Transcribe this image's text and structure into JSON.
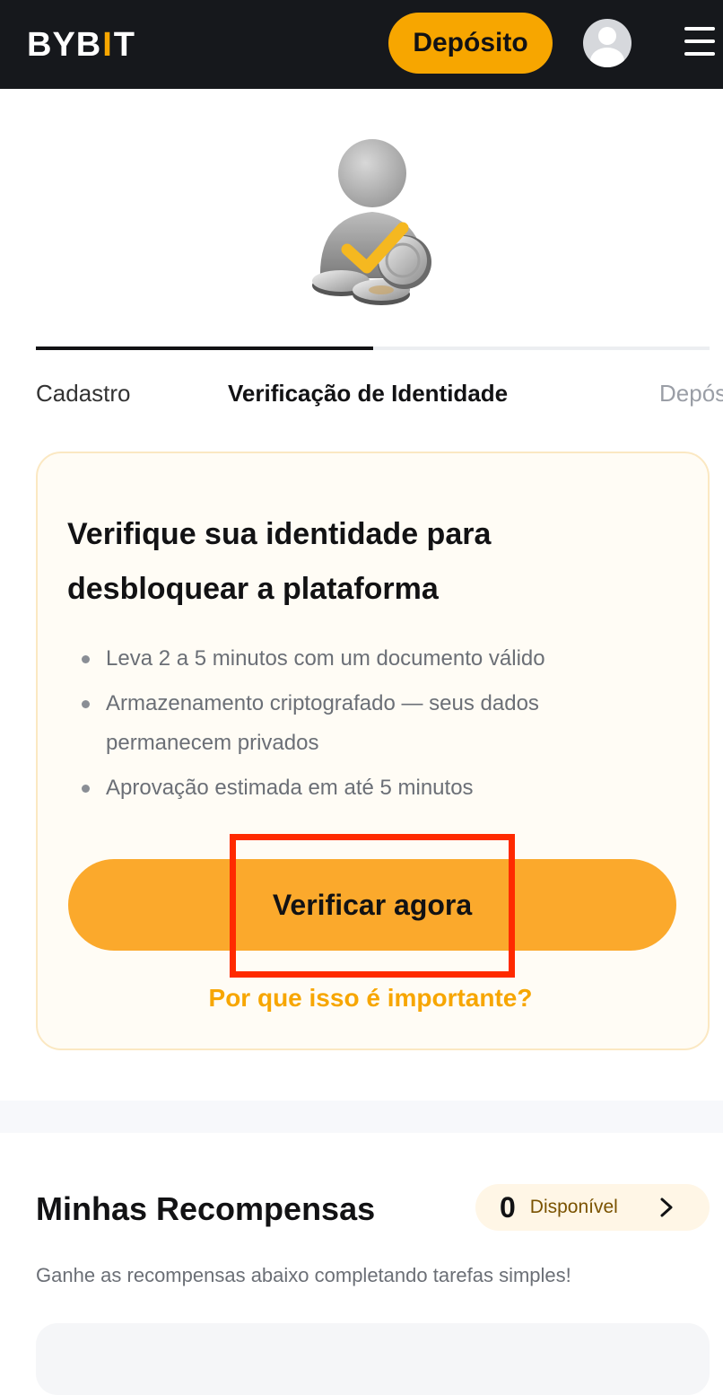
{
  "header": {
    "logo_text": "BYB",
    "logo_mark": "I",
    "logo_tail": "T",
    "deposit_label": "Depósito",
    "icons": [
      "avatar-icon",
      "hamburger-menu-icon"
    ]
  },
  "hero": {
    "icon": "user-verified-coins-icon"
  },
  "stepper": {
    "progress_fraction": 0.5,
    "steps": [
      {
        "label": "Cadastro",
        "state": "done"
      },
      {
        "label": "Verificação de Identidade",
        "state": "active"
      },
      {
        "label": "Depós",
        "state": "upcoming"
      }
    ]
  },
  "verification_card": {
    "title_line1": "Verifique sua identidade para",
    "title_line2": "desbloquear a plataforma",
    "bullets": [
      "Leva 2 a 5 minutos com um documento válido",
      "Armazenamento criptografado — seus dados permanecem privados",
      "Aprovação estimada em até 5 minutos"
    ],
    "button_label": "Verificar agora",
    "link_label": "Por que isso é importante?"
  },
  "rewards": {
    "title": "Minhas Recompensas",
    "available_count": "0",
    "available_label": "Disponível",
    "subtitle": "Ganhe as recompensas abaixo completando tarefas simples!"
  },
  "colors": {
    "header_bg": "#16181c",
    "accent": "#f7a600",
    "button": "#fba92c",
    "highlight": "#ff2a00",
    "card_bg": "#fffcf5"
  }
}
